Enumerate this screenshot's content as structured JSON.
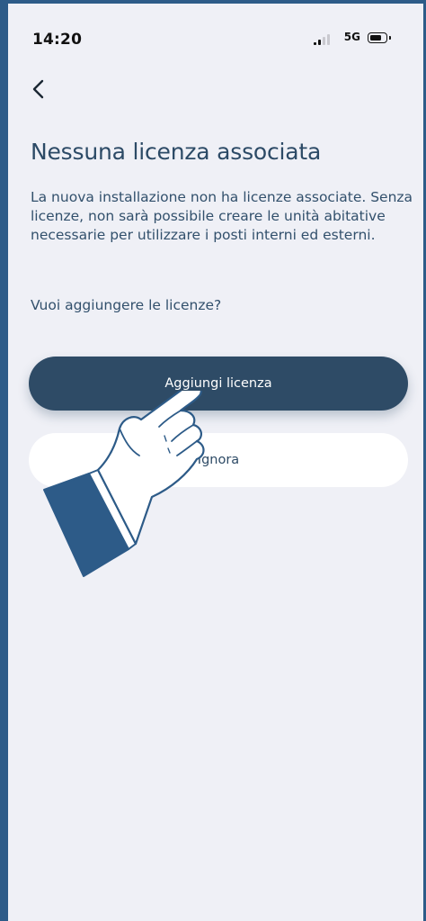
{
  "status_bar": {
    "time": "14:20",
    "network": "5G",
    "signal_icon": "signal-bars-icon",
    "battery_icon": "battery-icon"
  },
  "nav": {
    "back_icon": "chevron-left-icon"
  },
  "content": {
    "title": "Nessuna licenza associata",
    "body": "La nuova installazione non ha licenze associate. Senza licenze, non sarà possibile creare le unità abitative necessarie per utilizzare i posti interni ed esterni.",
    "question": "Vuoi aggiungere le licenze?"
  },
  "actions": {
    "primary_label": "Aggiungi licenza",
    "secondary_label": "Ignora"
  },
  "overlay": {
    "pointer_icon": "pointing-hand-icon"
  },
  "colors": {
    "frame": "#2d5b88",
    "background": "#eff0f6",
    "primary": "#2e4b66",
    "text": "#32506c"
  }
}
